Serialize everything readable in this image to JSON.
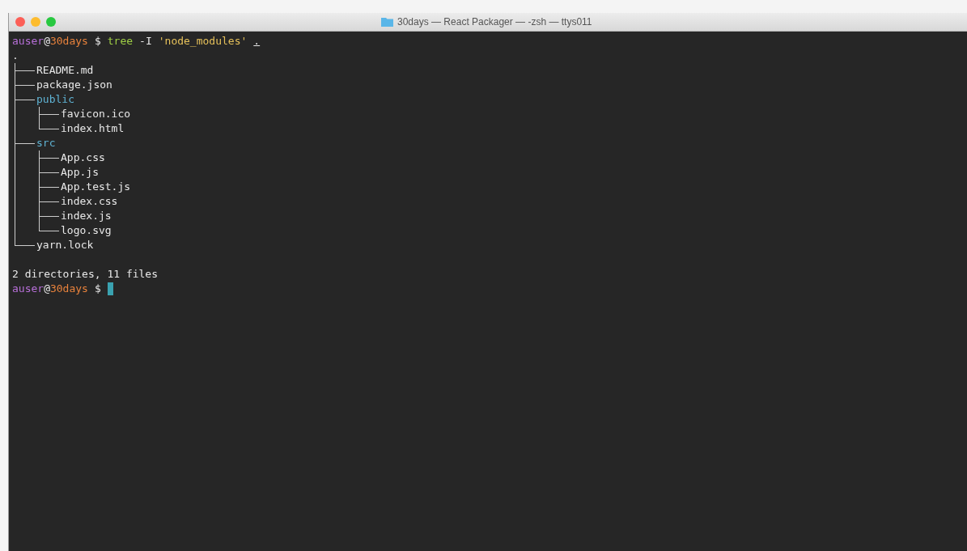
{
  "window": {
    "title": "30days — React Packager — -zsh — ttys011"
  },
  "terminal": {
    "lines": [
      {
        "kind": "prompt",
        "user": "auser",
        "at": "@",
        "host": "30days",
        "symbol": "$",
        "tokens": [
          {
            "text": "tree",
            "kind": "command"
          },
          {
            "text": "-I",
            "kind": "flag"
          },
          {
            "text": "'node_modules'",
            "kind": "string"
          },
          {
            "text": ".",
            "kind": "path"
          }
        ]
      },
      {
        "kind": "tree",
        "root": ".",
        "children": [
          {
            "name": "README.md",
            "kind": "file"
          },
          {
            "name": "package.json",
            "kind": "file"
          },
          {
            "name": "public",
            "kind": "directory",
            "children": [
              {
                "name": "favicon.ico",
                "kind": "file"
              },
              {
                "name": "index.html",
                "kind": "file"
              }
            ]
          },
          {
            "name": "src",
            "kind": "directory",
            "children": [
              {
                "name": "App.css",
                "kind": "file"
              },
              {
                "name": "App.js",
                "kind": "file"
              },
              {
                "name": "App.test.js",
                "kind": "file"
              },
              {
                "name": "index.css",
                "kind": "file"
              },
              {
                "name": "index.js",
                "kind": "file"
              },
              {
                "name": "logo.svg",
                "kind": "file"
              }
            ]
          },
          {
            "name": "yarn.lock",
            "kind": "file"
          }
        ]
      },
      {
        "kind": "blank"
      },
      {
        "kind": "output",
        "text": "2 directories, 11 files"
      },
      {
        "kind": "prompt",
        "user": "auser",
        "at": "@",
        "host": "30days",
        "symbol": "$",
        "cursor": true
      }
    ]
  }
}
